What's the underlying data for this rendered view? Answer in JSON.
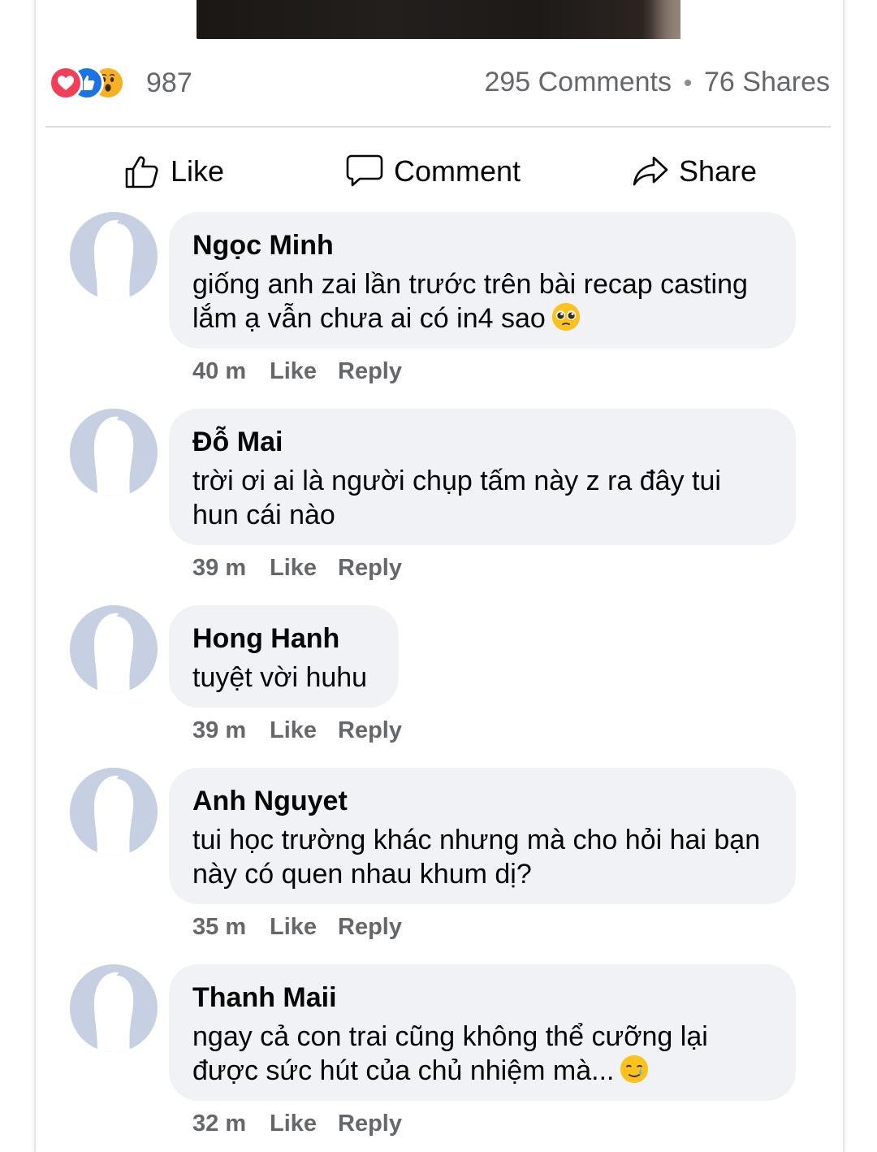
{
  "reactions": {
    "count": "987",
    "icons": [
      "love-icon",
      "like-icon",
      "wow-icon"
    ],
    "colors": {
      "love": "#f33e58",
      "like": "#1b74e4",
      "wow": "#f7b125"
    }
  },
  "stats": {
    "comments": "295 Comments",
    "shares": "76 Shares"
  },
  "actions": {
    "like": "Like",
    "comment": "Comment",
    "share": "Share"
  },
  "comments": [
    {
      "name": "Ngọc Minh",
      "text": "giống anh zai lần trước trên bài recap casting lắm ạ vẫn chưa ai có in4 sao",
      "emoji": "pleading-face-emoji",
      "time": "40 m",
      "like": "Like",
      "reply": "Reply"
    },
    {
      "name": "Đỗ Mai",
      "text": "trời ơi ai là người chụp tấm này z ra đây tui hun cái nào",
      "time": "39 m",
      "like": "Like",
      "reply": "Reply"
    },
    {
      "name": "Hong Hanh",
      "text": "tuyệt vời huhu",
      "time": "39 m",
      "like": "Like",
      "reply": "Reply"
    },
    {
      "name": "Anh Nguyet",
      "text": "tui học trường khác nhưng mà cho hỏi hai bạn này có quen nhau khum dị?",
      "time": "35 m",
      "like": "Like",
      "reply": "Reply"
    },
    {
      "name": "Thanh Maii",
      "text": "ngay cả con trai cũng không thể cưỡng lại được sức hút của chủ nhiệm mà...",
      "emoji": "crying-smile-emoji",
      "time": "32 m",
      "like": "Like",
      "reply": "Reply"
    }
  ]
}
